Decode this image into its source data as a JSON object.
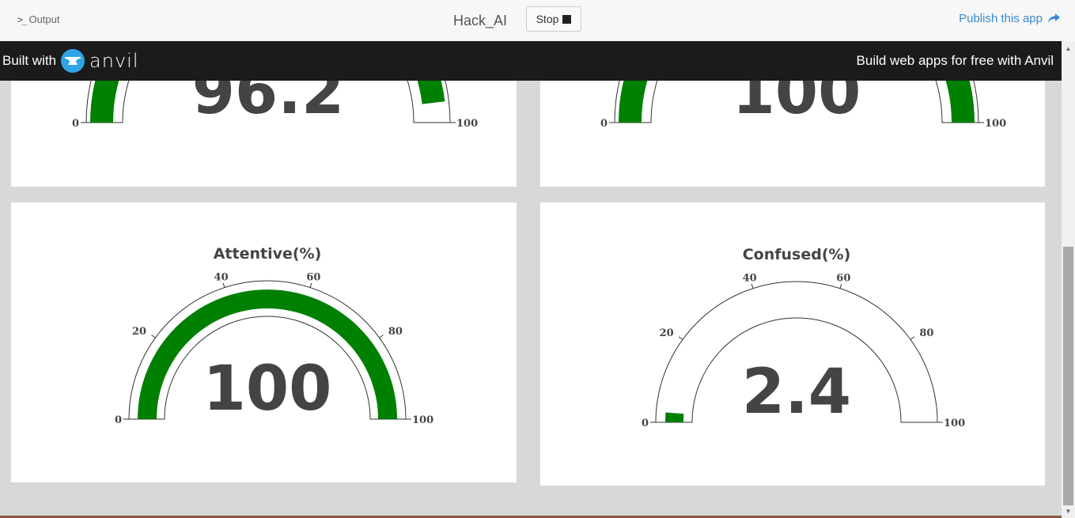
{
  "topbar": {
    "output_prompt": ">_",
    "output_label": "Output",
    "app_name": "Hack_AI",
    "stop_label": "Stop",
    "publish_label": "Publish this app"
  },
  "banner": {
    "built_with": "Built with",
    "logo_word": "anvil",
    "build_free": "Build web apps for free with Anvil"
  },
  "colors": {
    "gauge_fill": "#008000",
    "text": "#444444",
    "banner_bg": "#1b1b1b",
    "link": "#3a8bd1"
  },
  "chart_data": [
    {
      "type": "gauge",
      "title": "",
      "value": 96.2,
      "display": "96.2",
      "range": [
        0,
        100
      ],
      "ticks": [
        0,
        20,
        40,
        60,
        80,
        100
      ],
      "visible_ticks": [
        "0",
        "100"
      ]
    },
    {
      "type": "gauge",
      "title": "",
      "value": 100,
      "display": "100",
      "range": [
        0,
        100
      ],
      "ticks": [
        0,
        20,
        40,
        60,
        80,
        100
      ],
      "visible_ticks": [
        "0",
        "100"
      ]
    },
    {
      "type": "gauge",
      "title": "Attentive(%)",
      "value": 100,
      "display": "100",
      "range": [
        0,
        100
      ],
      "ticks": [
        0,
        20,
        40,
        60,
        80,
        100
      ],
      "visible_ticks": [
        "0",
        "20",
        "40",
        "60",
        "80",
        "100"
      ]
    },
    {
      "type": "gauge",
      "title": "Confused(%)",
      "value": 2.4,
      "display": "2.4",
      "range": [
        0,
        100
      ],
      "ticks": [
        0,
        20,
        40,
        60,
        80,
        100
      ],
      "visible_ticks": [
        "0",
        "20",
        "40",
        "60",
        "80",
        "100"
      ]
    }
  ]
}
